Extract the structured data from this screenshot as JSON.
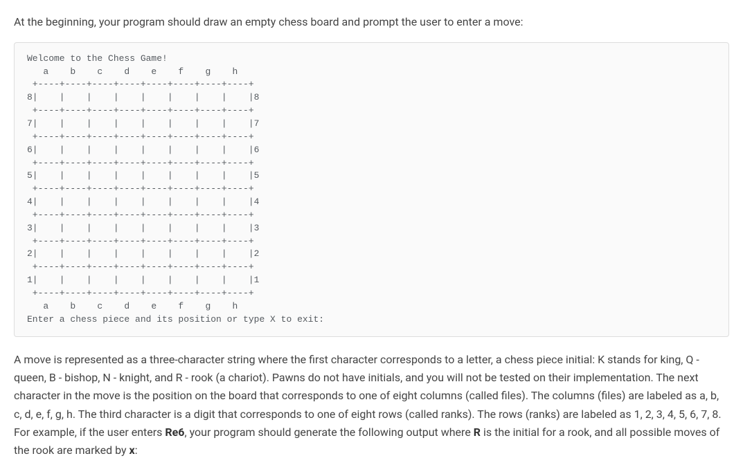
{
  "intro": "At the beginning, your program should draw an empty chess board and prompt the user to enter a move:",
  "code": "Welcome to the Chess Game!\n   a    b    c    d    e    f    g    h\n +----+----+----+----+----+----+----+----+\n8|    |    |    |    |    |    |    |    |8\n +----+----+----+----+----+----+----+----+\n7|    |    |    |    |    |    |    |    |7\n +----+----+----+----+----+----+----+----+\n6|    |    |    |    |    |    |    |    |6\n +----+----+----+----+----+----+----+----+\n5|    |    |    |    |    |    |    |    |5\n +----+----+----+----+----+----+----+----+\n4|    |    |    |    |    |    |    |    |4\n +----+----+----+----+----+----+----+----+\n3|    |    |    |    |    |    |    |    |3\n +----+----+----+----+----+----+----+----+\n2|    |    |    |    |    |    |    |    |2\n +----+----+----+----+----+----+----+----+\n1|    |    |    |    |    |    |    |    |1\n +----+----+----+----+----+----+----+----+\n   a    b    c    d    e    f    g    h\nEnter a chess piece and its position or type X to exit:",
  "desc": {
    "p1a": "A move is represented as a three-character string where the first character corresponds to a letter, a chess piece initial: K stands for king, Q - queen, B - bishop, N - knight, and R - rook (a chariot). Pawns do not have initials, and you will not be tested on their implementation. The next character in the move is the position on the board that corresponds to one of eight columns (called files). The columns (files) are labeled as a, b, c, d, e, f, g, h. The third character is a digit that corresponds to one of eight rows (called ranks). The rows (ranks) are labeled as 1, 2, 3, 4, 5, 6, 7, 8. For example, if the user enters ",
    "b1": "Re6",
    "p1b": ", your program should generate the following output where ",
    "b2": "R",
    "p1c": " is the initial for a rook, and all possible moves of the rook are marked by ",
    "b3": "x",
    "p1d": ":"
  }
}
